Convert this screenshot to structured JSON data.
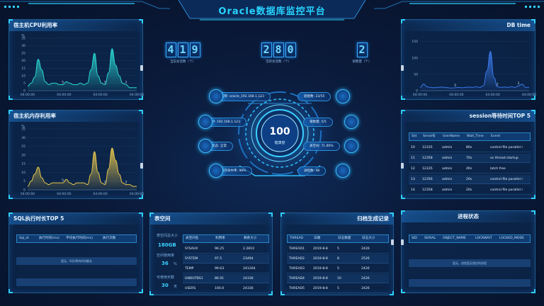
{
  "header": {
    "title": "Oracle数据库监控平台"
  },
  "cpu_panel": {
    "title": "宿主机CPU利用率",
    "unit": "%"
  },
  "mem_panel": {
    "title": "宿主机内存利用率",
    "unit": "%"
  },
  "dbtime_panel": {
    "title": "DB time"
  },
  "chart_data": [
    {
      "type": "area",
      "ylabel": "%",
      "x_ticks": [
        "04:00:00",
        "04:00:00",
        "04:00:00",
        "04:00:00"
      ],
      "y_ticks": [
        0,
        5,
        10,
        15,
        20,
        25,
        30,
        35
      ],
      "ylim": [
        0,
        35
      ],
      "values": [
        3,
        5,
        9,
        21,
        14,
        6,
        4,
        5,
        5,
        4,
        4,
        6,
        5,
        4,
        4,
        5,
        4,
        5,
        14,
        25,
        10,
        5,
        4,
        12,
        28,
        17,
        10,
        5,
        4,
        2,
        2,
        2
      ],
      "point_labels": [
        {
          "index": 10,
          "text": "5"
        },
        {
          "index": 22,
          "text": "2"
        },
        {
          "index": 28,
          "text": "2"
        }
      ],
      "color": "#2ad6d0"
    },
    {
      "type": "area",
      "ylabel": "%",
      "x_ticks": [
        "04:00:00",
        "04:00:00",
        "04:00:00",
        "04:00:00"
      ],
      "y_ticks": [
        0,
        5,
        10,
        15,
        20,
        25,
        30,
        35
      ],
      "ylim": [
        0,
        35
      ],
      "values": [
        2,
        5,
        9,
        13,
        7,
        4,
        3,
        4,
        4,
        4,
        4,
        6,
        4,
        3,
        4,
        4,
        4,
        3,
        9,
        22,
        10,
        4,
        3,
        12,
        24,
        17,
        9,
        4,
        3,
        3,
        2,
        2
      ],
      "point_labels": [
        {
          "index": 10,
          "text": "5"
        },
        {
          "index": 22,
          "text": "2"
        },
        {
          "index": 28,
          "text": "2"
        }
      ],
      "color": "#e3c54d"
    },
    {
      "type": "area",
      "ylabel": "",
      "x_ticks": [
        "04:00:00",
        "04:00:00",
        "04:00:00",
        "04:00:00"
      ],
      "y_ticks": [
        0,
        50,
        100,
        150
      ],
      "ylim": [
        0,
        160
      ],
      "values": [
        10,
        20,
        12,
        10,
        9,
        10,
        11,
        10,
        9,
        8,
        9,
        10,
        9,
        10,
        11,
        10,
        12,
        10,
        15,
        60,
        120,
        40,
        12,
        10,
        11,
        10,
        12,
        10,
        15,
        20,
        10,
        10
      ],
      "point_labels": [
        {
          "index": 10,
          "text": "5"
        },
        {
          "index": 22,
          "text": "2"
        },
        {
          "index": 28,
          "text": "2"
        }
      ],
      "color": "#3a78e8"
    }
  ],
  "kpis": [
    {
      "digits": [
        "4",
        "1",
        "9"
      ],
      "label": "当前会话数（个）"
    },
    {
      "digits": [
        "2",
        "8",
        "0"
      ],
      "label": "活跃会话数（个）"
    },
    {
      "digits": [
        "2"
      ],
      "label": "锁数量（个）"
    }
  ],
  "center": {
    "score": "100",
    "score_label": "健康度",
    "nodes": [
      {
        "text": "名称: oracle_192.168.1.123",
        "side": "left"
      },
      {
        "text": "IP: 192.168.1.123",
        "side": "left"
      },
      {
        "text": "状态: 正常",
        "side": "left"
      },
      {
        "text": "缓存命中率: 98%",
        "side": "left"
      },
      {
        "text": "链接数: 23/55",
        "side": "right"
      },
      {
        "text": "锁数量: 5/5",
        "side": "right"
      },
      {
        "text": "表空间: 71.86%",
        "side": "right"
      },
      {
        "text": "进程数: 48",
        "side": "right"
      }
    ]
  },
  "session_panel": {
    "title": "session等待时间TOP 5",
    "headers": [
      "Sid",
      "Serial号",
      "UserName",
      "Wait_Time",
      "Event"
    ],
    "rows": [
      [
        "10",
        "12335",
        "admin",
        "80s",
        "control file parallel r"
      ],
      [
        "11",
        "12358",
        "admin",
        "70s",
        "os thread startup"
      ],
      [
        "12",
        "12335",
        "admin",
        "40s",
        "latch free"
      ],
      [
        "13",
        "12356",
        "admin",
        "20s",
        "control file parallel r"
      ],
      [
        "14",
        "12358",
        "admin",
        "20s",
        "control file parallel r"
      ]
    ]
  },
  "sql_panel": {
    "title": "SQL执行时长TOP 5",
    "headers": [
      "Sql_id",
      "执行时间(ms)",
      "平均执行时间(ms)",
      "执行次数"
    ],
    "empty": "暂无，SQL等待时间最长"
  },
  "tablespace_panel": {
    "title": "表空间",
    "stats": [
      {
        "label": "表空间总大小",
        "value": "180GB"
      },
      {
        "label": "空间使用率",
        "value": "36",
        "unit": "%"
      },
      {
        "label": "可使用天数",
        "value": "30",
        "unit": "天"
      }
    ],
    "headers": [
      "表空间名",
      "利用率",
      "剩余大小"
    ],
    "rows": [
      [
        "SYSAUX",
        "96.25",
        "2.2810"
      ],
      [
        "SYSTEM",
        "97.5",
        "23494"
      ],
      [
        "TEMP",
        "99.63",
        "241264"
      ],
      [
        "UNDOTBS1",
        "86.91",
        "24336"
      ],
      [
        "USERS",
        "100.0",
        "24336"
      ]
    ]
  },
  "archive_panel": {
    "title": "归档生成记录",
    "headers": [
      "THREAD",
      "日期",
      "日志数量",
      "日志大小"
    ],
    "rows": [
      [
        "THREAD1",
        "2019-8-8",
        "5",
        "2426"
      ],
      [
        "THREAD2",
        "2019-8-8",
        "8",
        "2526"
      ],
      [
        "THREAD3",
        "2019-8-8",
        "5",
        "2426"
      ],
      [
        "THREAD4",
        "2019-8-8",
        "10",
        "2426"
      ],
      [
        "THREAD5",
        "2019-8-8",
        "5",
        "2426"
      ]
    ]
  },
  "process_panel": {
    "title": "进程状态",
    "headers": [
      "SID",
      "SERIAL",
      "OBJECT_NAME",
      "LOCKWAIT",
      "LOCKED_MODE"
    ],
    "empty": "暂无，进程暂无锁住的进程"
  }
}
